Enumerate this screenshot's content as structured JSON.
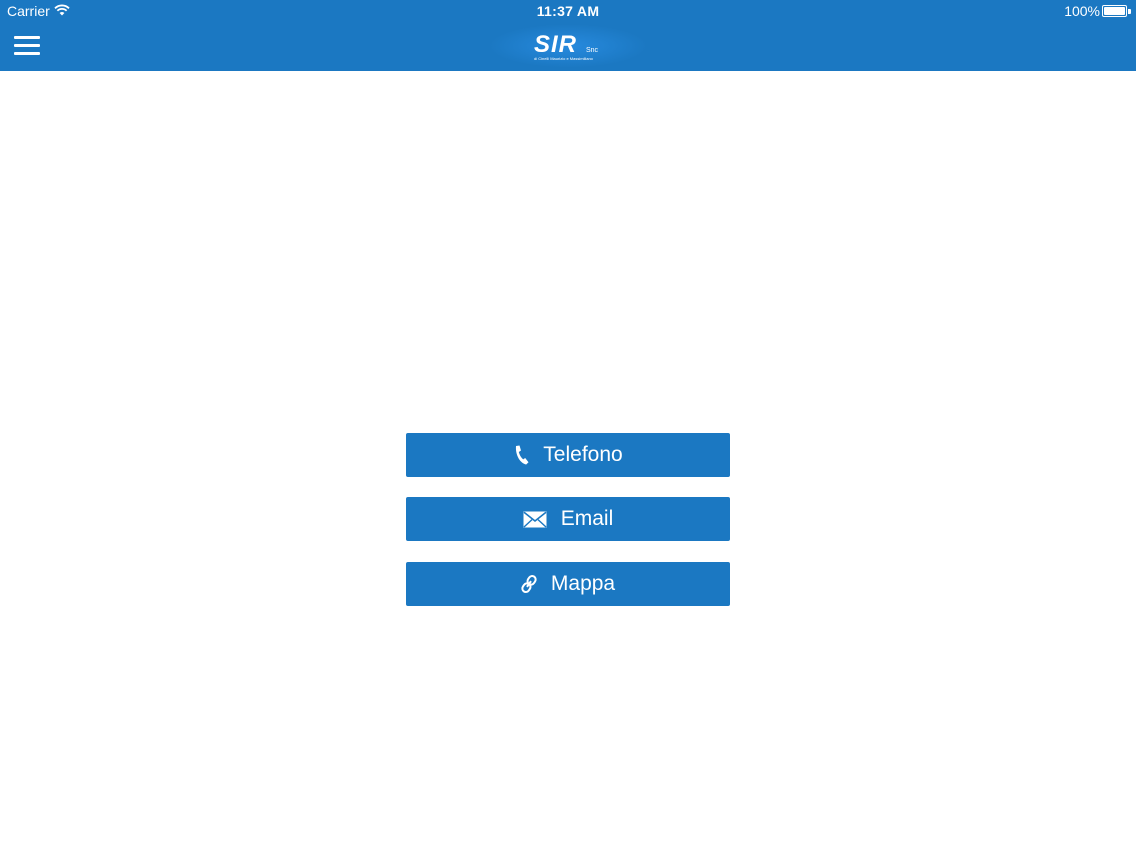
{
  "status_bar": {
    "carrier": "Carrier",
    "time": "11:37 AM",
    "battery_percent": "100%",
    "battery_level": 1.0
  },
  "header": {
    "background_color": "#1b78c2",
    "menu_icon": "hamburger-menu-icon",
    "logo": {
      "text": "SIR",
      "suffix": "Snc",
      "tagline": "di Cinelli Maurizio e Massimiliano"
    }
  },
  "buttons": [
    {
      "label": "Telefono",
      "icon": "phone-icon"
    },
    {
      "label": "Email",
      "icon": "envelope-icon"
    },
    {
      "label": "Mappa",
      "icon": "map-link-icon"
    }
  ],
  "colors": {
    "accent": "#1b78c2",
    "background": "#ffffff",
    "button_text": "#ffffff"
  }
}
